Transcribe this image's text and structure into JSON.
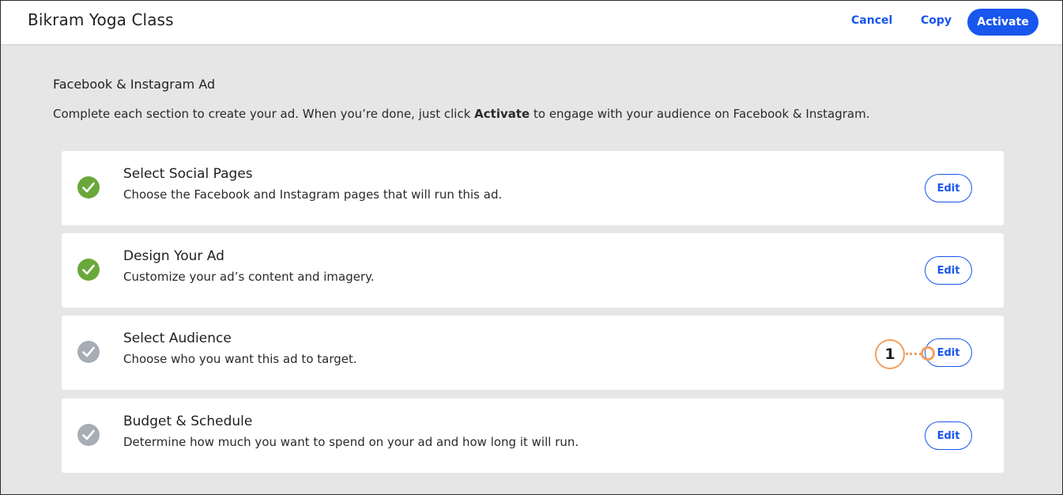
{
  "header": {
    "title": "Bikram Yoga Class",
    "cancel_label": "Cancel",
    "copy_label": "Copy",
    "activate_label": "Activate"
  },
  "main": {
    "heading": "Facebook & Instagram Ad",
    "intro_before": "Complete each section to create your ad. When you’re done, just click ",
    "intro_bold": "Activate",
    "intro_after": " to engage with your audience on Facebook & Instagram.",
    "sections": [
      {
        "title": "Select Social Pages",
        "description": "Choose the Facebook and Instagram pages that will run this ad.",
        "status": "complete",
        "edit_label": "Edit"
      },
      {
        "title": "Design Your Ad",
        "description": "Customize your ad’s content and imagery.",
        "status": "complete",
        "edit_label": "Edit"
      },
      {
        "title": "Select Audience",
        "description": "Choose who you want this ad to target.",
        "status": "incomplete",
        "edit_label": "Edit"
      },
      {
        "title": "Budget & Schedule",
        "description": "Determine how much you want to spend on your ad and how long it will run.",
        "status": "incomplete",
        "edit_label": "Edit"
      }
    ]
  },
  "callout": {
    "number": "1"
  },
  "colors": {
    "accent": "#1856ed",
    "complete": "#6aa83a",
    "incomplete": "#a6adb4",
    "callout": "#f0a060",
    "background": "#e6e6e6"
  },
  "icons": {
    "complete": "checkmark-icon",
    "incomplete": "checkmark-icon"
  }
}
